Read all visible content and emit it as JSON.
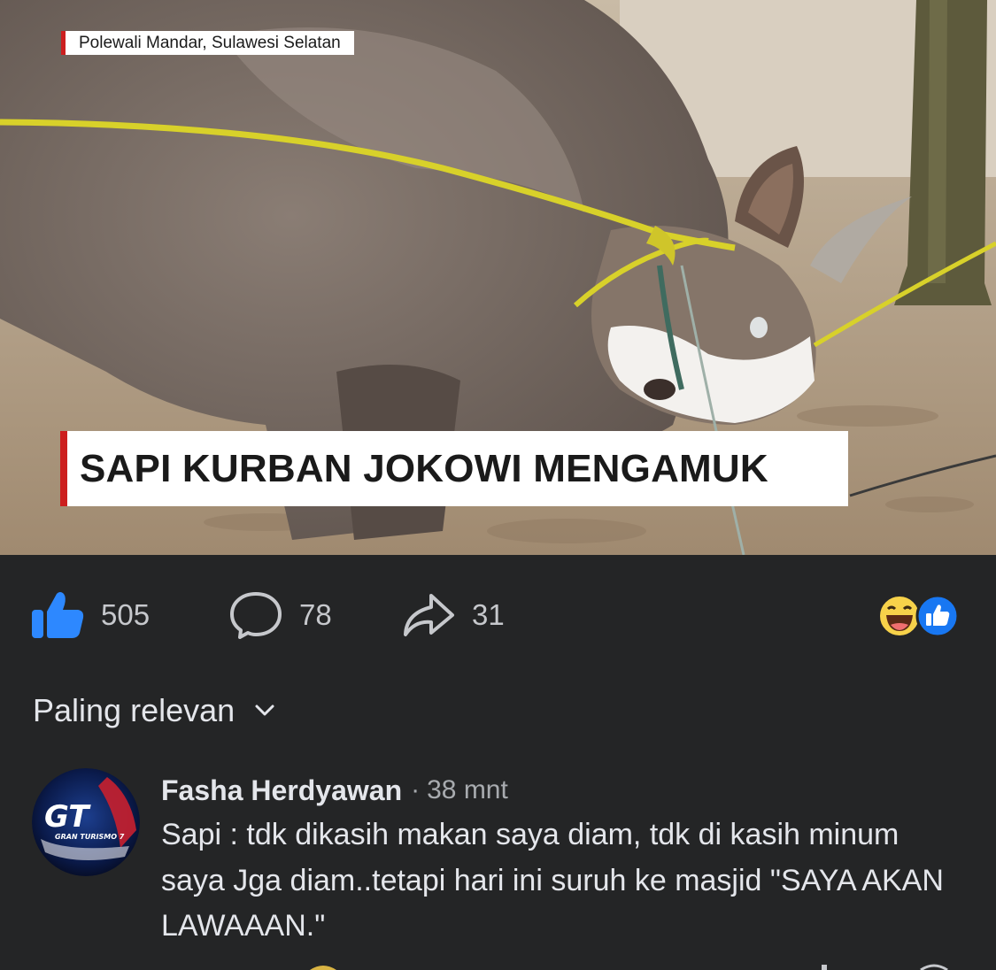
{
  "video": {
    "location_tag": "Polewali Mandar, Sulawesi Selatan",
    "headline": "SAPI KURBAN JOKOWI MENGAMUK",
    "accent_color": "#cc1f1f"
  },
  "actions": {
    "like": {
      "icon": "thumbs-up-icon",
      "count": "505",
      "color": "#2d88ff"
    },
    "comment": {
      "icon": "comment-bubble-icon",
      "count": "78"
    },
    "share": {
      "icon": "share-arrow-icon",
      "count": "31"
    },
    "reactions": [
      "haha-reaction-icon",
      "like-reaction-icon"
    ]
  },
  "sort": {
    "label": "Paling relevan",
    "icon": "chevron-down-icon"
  },
  "comments": [
    {
      "author": "Fasha Herdyawan",
      "separator": "·",
      "time": "38 mnt",
      "text": "Sapi : tdk dikasih makan saya diam, tdk di kasih minum saya Jga diam..tetapi hari ini suruh ke masjid \"SAYA AKAN LAWAAAN.\"",
      "avatar": {
        "logo_text": "GRAN TURISMO 7"
      }
    }
  ]
}
